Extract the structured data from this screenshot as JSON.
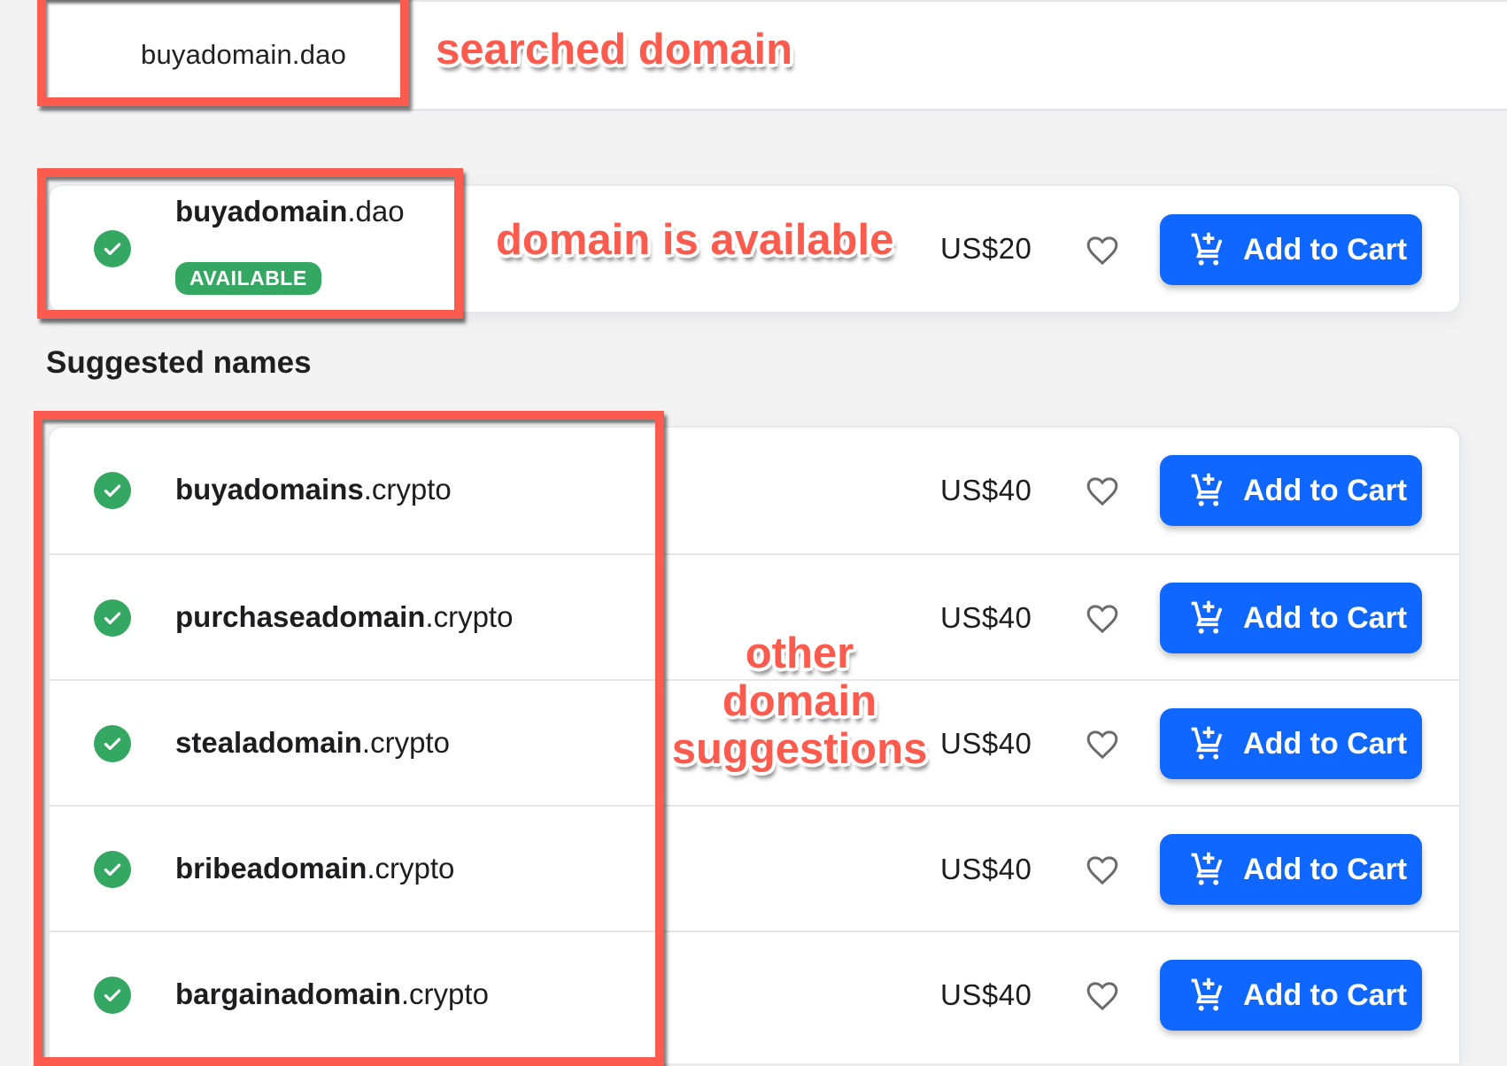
{
  "search": {
    "query": "buyadomain.dao"
  },
  "featured": {
    "name": "buyadomain",
    "tld": ".dao",
    "status_badge": "AVAILABLE",
    "price": "US$20",
    "add_to_cart_label": "Add to Cart"
  },
  "suggestions": {
    "heading": "Suggested names",
    "items": [
      {
        "name": "buyadomains",
        "tld": ".crypto",
        "price": "US$40",
        "add_to_cart_label": "Add to Cart"
      },
      {
        "name": "purchaseadomain",
        "tld": ".crypto",
        "price": "US$40",
        "add_to_cart_label": "Add to Cart"
      },
      {
        "name": "stealadomain",
        "tld": ".crypto",
        "price": "US$40",
        "add_to_cart_label": "Add to Cart"
      },
      {
        "name": "bribeadomain",
        "tld": ".crypto",
        "price": "US$40",
        "add_to_cart_label": "Add to Cart"
      },
      {
        "name": "bargainadomain",
        "tld": ".crypto",
        "price": "US$40",
        "add_to_cart_label": "Add to Cart"
      }
    ]
  },
  "annotations": {
    "searched": "searched domain",
    "available": "domain is available",
    "suggestions_line1": "other",
    "suggestions_line2": "domain",
    "suggestions_line3": "suggestions"
  },
  "colors": {
    "accent": "#0f67ff",
    "available": "#34a862",
    "annotation": "#fd5b4d"
  },
  "icons": {
    "check": "check-circle-icon",
    "heart": "heart-outline-icon",
    "cart": "cart-plus-icon"
  }
}
